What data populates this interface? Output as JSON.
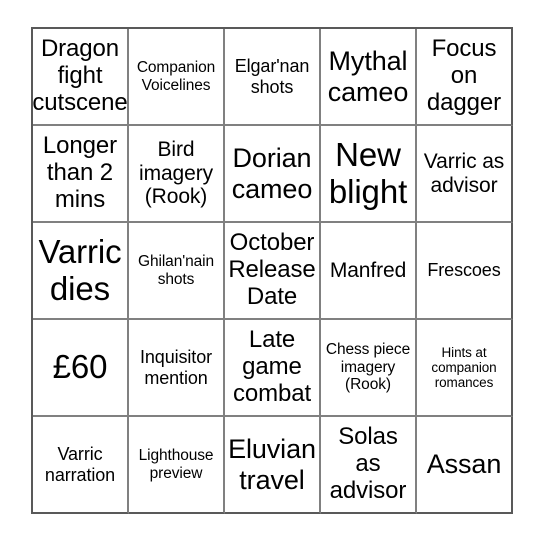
{
  "card": {
    "type": "bingo-card",
    "rows": 5,
    "columns": 5,
    "colors": {
      "background": "#ffffff",
      "grid_line": "#808080",
      "outer_border": "#595959",
      "text": "#000000"
    },
    "cells": [
      {
        "text": "Dragon fight cutscene",
        "size": "fs-xl"
      },
      {
        "text": "Companion Voicelines",
        "size": "fs-s"
      },
      {
        "text": "Elgar'nan shots",
        "size": "fs-m"
      },
      {
        "text": "Mythal cameo",
        "size": "fs-xxl"
      },
      {
        "text": "Focus on dagger",
        "size": "fs-xl"
      },
      {
        "text": "Longer than 2 mins",
        "size": "fs-xl"
      },
      {
        "text": "Bird imagery (Rook)",
        "size": "fs-l"
      },
      {
        "text": "Dorian cameo",
        "size": "fs-xxl"
      },
      {
        "text": "New blight",
        "size": "fs-huge"
      },
      {
        "text": "Varric as advisor",
        "size": "fs-l"
      },
      {
        "text": "Varric dies",
        "size": "fs-huge"
      },
      {
        "text": "Ghilan'nain shots",
        "size": "fs-s"
      },
      {
        "text": "October Release Date",
        "size": "fs-xl"
      },
      {
        "text": "Manfred",
        "size": "fs-l"
      },
      {
        "text": "Frescoes",
        "size": "fs-m"
      },
      {
        "text": "£60",
        "size": "fs-huge"
      },
      {
        "text": "Inquisitor mention",
        "size": "fs-m"
      },
      {
        "text": "Late game combat",
        "size": "fs-xl"
      },
      {
        "text": "Chess piece imagery (Rook)",
        "size": "fs-s"
      },
      {
        "text": "Hints at companion romances",
        "size": "fs-xs"
      },
      {
        "text": "Varric narration",
        "size": "fs-m"
      },
      {
        "text": "Lighthouse preview",
        "size": "fs-s"
      },
      {
        "text": "Eluvian travel",
        "size": "fs-xxl"
      },
      {
        "text": "Solas as advisor",
        "size": "fs-xl"
      },
      {
        "text": "Assan",
        "size": "fs-xxl"
      }
    ]
  }
}
